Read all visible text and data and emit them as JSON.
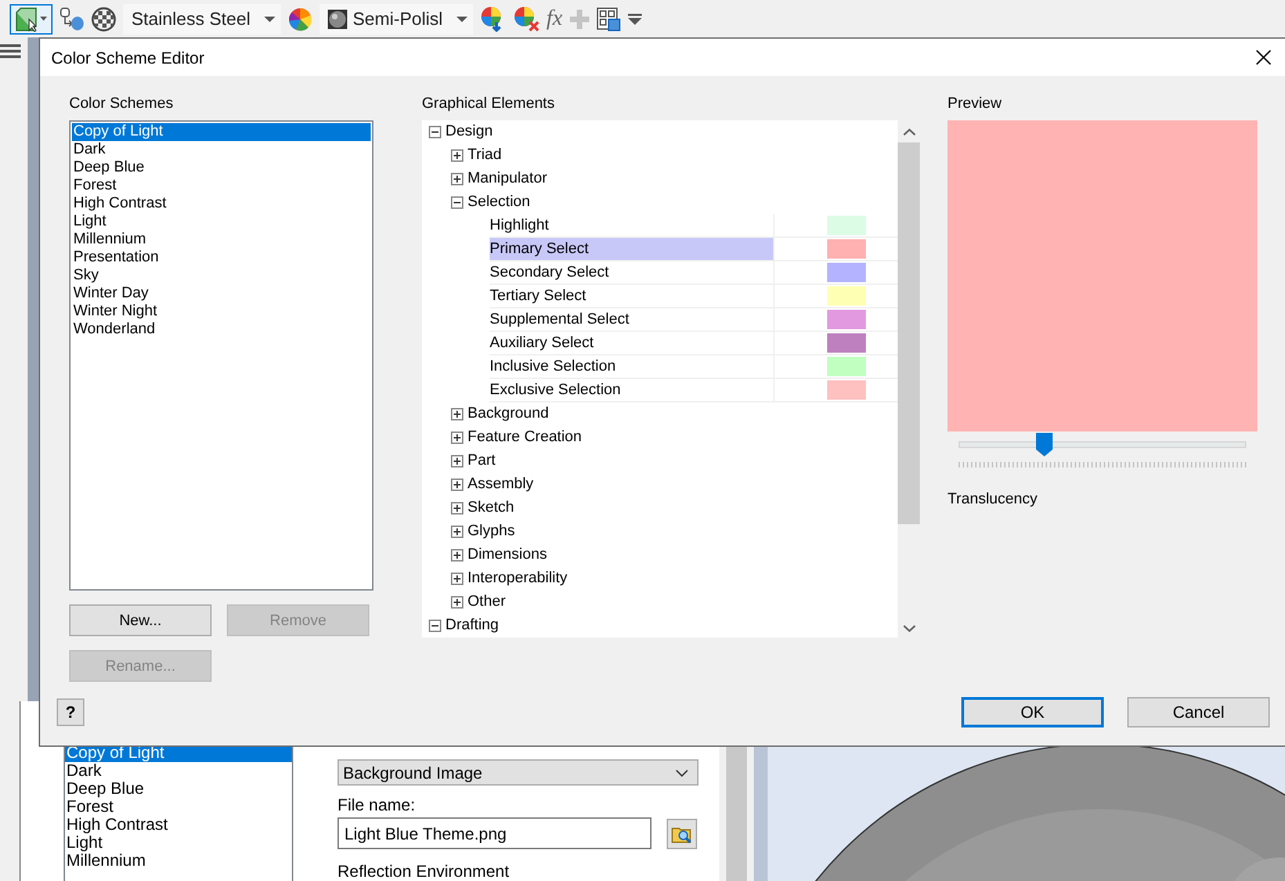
{
  "toolbar": {
    "appearance_button": {
      "selected": true
    },
    "material": "Stainless Steel",
    "finish": "Semi-Polisl",
    "formula": "fx"
  },
  "dialog": {
    "title": "Color Scheme Editor",
    "schemes": {
      "label": "Color Schemes",
      "items": [
        {
          "name": "Copy of Light",
          "selected": true
        },
        {
          "name": "Dark",
          "selected": false
        },
        {
          "name": "Deep Blue",
          "selected": false
        },
        {
          "name": "Forest",
          "selected": false
        },
        {
          "name": "High Contrast",
          "selected": false
        },
        {
          "name": "Light",
          "selected": false
        },
        {
          "name": "Millennium",
          "selected": false
        },
        {
          "name": "Presentation",
          "selected": false
        },
        {
          "name": "Sky",
          "selected": false
        },
        {
          "name": "Winter Day",
          "selected": false
        },
        {
          "name": "Winter Night",
          "selected": false
        },
        {
          "name": "Wonderland",
          "selected": false
        }
      ],
      "buttons": [
        {
          "label": "New...",
          "disabled": false
        },
        {
          "label": "Remove",
          "disabled": true
        }
      ],
      "rename": {
        "label": "Rename...",
        "disabled": true
      }
    },
    "elements": {
      "label": "Graphical Elements",
      "tree": [
        {
          "kind": "group",
          "label": "Design",
          "expanded": true,
          "selected": false,
          "children": [
            {
              "kind": "group",
              "label": "Triad",
              "expanded": false,
              "selected": false
            },
            {
              "kind": "group",
              "label": "Manipulator",
              "expanded": false,
              "selected": false
            },
            {
              "kind": "group",
              "label": "Selection",
              "expanded": true,
              "selected": false,
              "children": [
                {
                  "kind": "color",
                  "label": "Highlight",
                  "color": "#dcfce6",
                  "selected": false
                },
                {
                  "kind": "color",
                  "label": "Primary Select",
                  "color": "#ffb0b0",
                  "selected": true
                },
                {
                  "kind": "color",
                  "label": "Secondary Select",
                  "color": "#b3b3ff",
                  "selected": false
                },
                {
                  "kind": "color",
                  "label": "Tertiary Select",
                  "color": "#ffffb3",
                  "selected": false
                },
                {
                  "kind": "color",
                  "label": "Supplemental Select",
                  "color": "#e399e0",
                  "selected": false
                },
                {
                  "kind": "color",
                  "label": "Auxiliary Select",
                  "color": "#bf80bf",
                  "selected": false
                },
                {
                  "kind": "color",
                  "label": "Inclusive Selection",
                  "color": "#c0ffc0",
                  "selected": false
                },
                {
                  "kind": "color",
                  "label": "Exclusive Selection",
                  "color": "#ffc0c0",
                  "selected": false
                }
              ]
            },
            {
              "kind": "group",
              "label": "Background",
              "expanded": false,
              "selected": false
            },
            {
              "kind": "group",
              "label": "Feature Creation",
              "expanded": false,
              "selected": false
            },
            {
              "kind": "group",
              "label": "Part",
              "expanded": false,
              "selected": false
            },
            {
              "kind": "group",
              "label": "Assembly",
              "expanded": false,
              "selected": false
            },
            {
              "kind": "group",
              "label": "Sketch",
              "expanded": false,
              "selected": false
            },
            {
              "kind": "group",
              "label": "Glyphs",
              "expanded": false,
              "selected": false
            },
            {
              "kind": "group",
              "label": "Dimensions",
              "expanded": false,
              "selected": false
            },
            {
              "kind": "group",
              "label": "Interoperability",
              "expanded": false,
              "selected": false
            },
            {
              "kind": "group",
              "label": "Other",
              "expanded": false,
              "selected": false
            }
          ]
        },
        {
          "kind": "group",
          "label": "Drafting",
          "expanded": true,
          "selected": false
        }
      ]
    },
    "preview": {
      "label": "Preview",
      "color": "#ffb3b3",
      "translucency": {
        "label": "Translucency",
        "level": 0.3
      }
    },
    "help": "?",
    "buttons": [
      {
        "label": "OK",
        "default": true
      },
      {
        "label": "Cancel",
        "default": false
      }
    ]
  },
  "background_window": {
    "schemes": [
      {
        "name": "Copy of Light",
        "selected": true
      },
      {
        "name": "Dark",
        "selected": false
      },
      {
        "name": "Deep Blue",
        "selected": false
      },
      {
        "name": "Forest",
        "selected": false
      },
      {
        "name": "High Contrast",
        "selected": false
      },
      {
        "name": "Light",
        "selected": false
      },
      {
        "name": "Millennium",
        "selected": false
      }
    ],
    "background_value": "Background Image",
    "file_label": "File name:",
    "file_name": "Light Blue Theme.png",
    "reflection_label": "Reflection Environment"
  }
}
